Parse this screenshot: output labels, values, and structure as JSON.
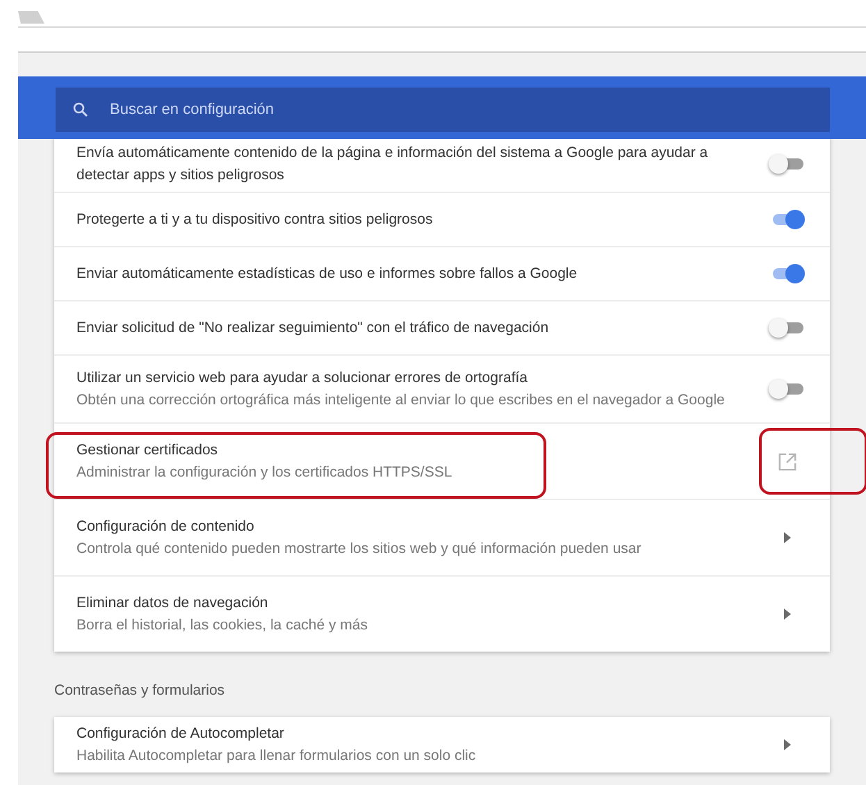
{
  "search": {
    "placeholder": "Buscar en configuración"
  },
  "rows": [
    {
      "kind": "toggle",
      "title": "Envía automáticamente contenido de la página e información del sistema a Google para ayudar a detectar apps y sitios peligrosos",
      "on": false
    },
    {
      "kind": "toggle",
      "title": "Protegerte a ti y a tu dispositivo contra sitios peligrosos",
      "on": true
    },
    {
      "kind": "toggle",
      "title": "Enviar automáticamente estadísticas de uso e informes sobre fallos a Google",
      "on": true
    },
    {
      "kind": "toggle",
      "title": "Enviar solicitud de \"No realizar seguimiento\" con el tráfico de navegación",
      "on": false
    },
    {
      "kind": "toggle",
      "title": "Utilizar un servicio web para ayudar a solucionar errores de ortografía",
      "subtitle": "Obtén una corrección ortográfica más inteligente al enviar lo que escribes en el navegador a Google",
      "on": false
    },
    {
      "kind": "external",
      "title": "Gestionar certificados",
      "subtitle": "Administrar la configuración y los certificados HTTPS/SSL",
      "highlighted": true
    },
    {
      "kind": "arrow",
      "title": "Configuración de contenido",
      "subtitle": "Controla qué contenido pueden mostrarte los sitios web y qué información pueden usar"
    },
    {
      "kind": "arrow",
      "title": "Eliminar datos de navegación",
      "subtitle": "Borra el historial, las cookies, la caché y más"
    }
  ],
  "section": {
    "heading": "Contraseñas y formularios",
    "rows": [
      {
        "kind": "arrow",
        "title": "Configuración de Autocompletar",
        "subtitle": "Habilita Autocompletar para llenar formularios con un solo clic"
      }
    ]
  }
}
